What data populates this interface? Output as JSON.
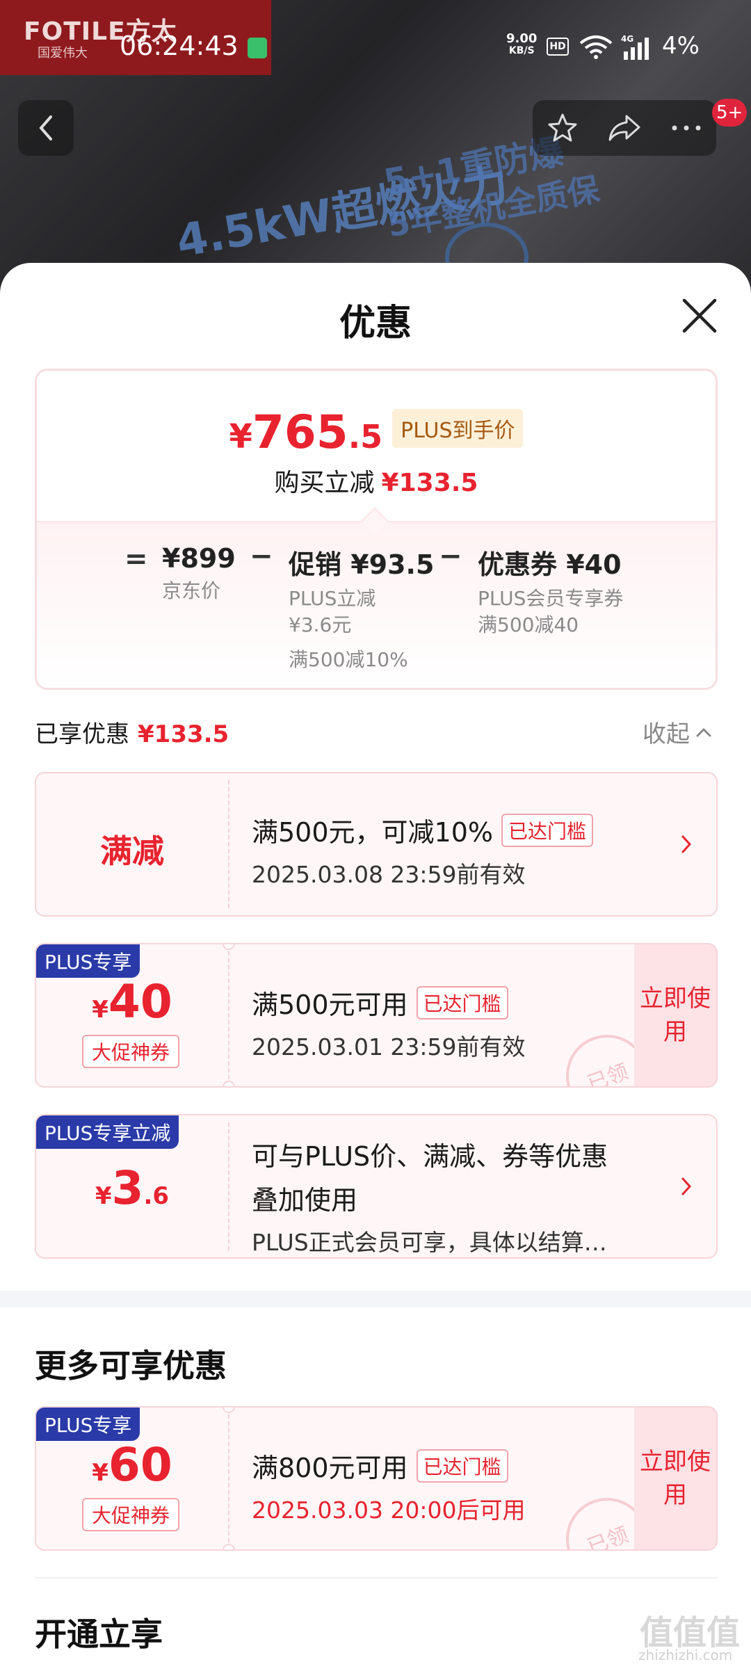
{
  "banner": {
    "brand_logo": "FOTILE方太",
    "brand_sub": "国爱伟大",
    "text1": "4.5kW超燃火力",
    "text2": "5+1重防爆",
    "text3": "5年整机全质保"
  },
  "status_bar": {
    "time": "06:24:43",
    "net_speed": "9.00",
    "net_unit": "KB/S",
    "hd": "HD",
    "network": "4G",
    "battery": "4%"
  },
  "nav": {
    "badge": "5+"
  },
  "sheet": {
    "title": "优惠"
  },
  "summary": {
    "price_currency": "¥",
    "price_int": "765",
    "price_dec": ".5",
    "plus_tag": "PLUS到手价",
    "reduce_label": "购买立减",
    "reduce_amount": "¥133.5",
    "eq": "=",
    "minus": "−",
    "jd_price": "¥899",
    "jd_label": "京东价",
    "promo_main": "促销 ¥93.5",
    "promo_sub1": "PLUS立减",
    "promo_sub2": "¥3.6元",
    "promo_sub3": "满500减10%",
    "coupon_main": "优惠券 ¥40",
    "coupon_sub1": "PLUS会员专享券",
    "coupon_sub2": "满500减40"
  },
  "enjoyed": {
    "label": "已享优惠",
    "amount": "¥133.5",
    "collapse": "收起"
  },
  "coupons": [
    {
      "left_title": "满减",
      "line1": "满500元，可减10%",
      "tag": "已达门槛",
      "line2": "2025.03.08 23:59前有效"
    },
    {
      "corner": "PLUS专享",
      "currency": "¥",
      "amount": "40",
      "promo_tag": "大促神券",
      "line1": "满500元可用",
      "tag": "已达门槛",
      "line2": "2025.03.01 23:59前有效",
      "use_now": "立即使用",
      "stamp": "已领"
    },
    {
      "corner": "PLUS专享立减",
      "currency": "¥",
      "amount": "3",
      "amount_dec": ".6",
      "line1": "可与PLUS价、满减、券等优惠",
      "line1b": "叠加使用",
      "line2": "PLUS正式会员可享，具体以结算…"
    }
  ],
  "more": {
    "title": "更多可享优惠",
    "coupon": {
      "corner": "PLUS专享",
      "currency": "¥",
      "amount": "60",
      "promo_tag": "大促神券",
      "line1": "满800元可用",
      "tag": "已达门槛",
      "line2": "2025.03.03 20:00后可用",
      "use_now": "立即使用",
      "stamp": "已领"
    }
  },
  "open": {
    "title": "开通立享"
  },
  "watermark": {
    "text": "值值值",
    "site": "zhizhizhi.com"
  },
  "colors": {
    "accent_red": "#e8232f",
    "plus_blue": "#2a3aa8"
  }
}
